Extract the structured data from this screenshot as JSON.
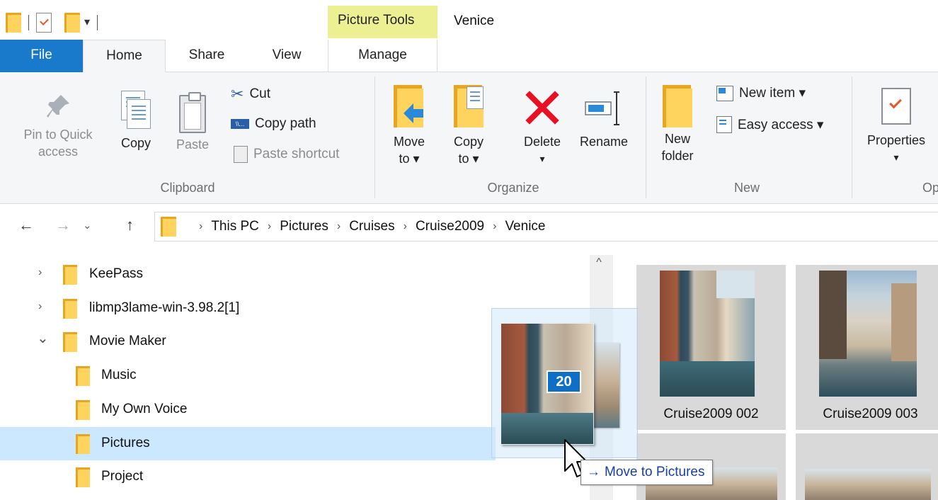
{
  "title_bar": {
    "contextual_tab_group": "Picture Tools",
    "window_title": "Venice"
  },
  "tabs": {
    "file": "File",
    "home": "Home",
    "share": "Share",
    "view": "View",
    "manage": "Manage"
  },
  "ribbon": {
    "clipboard": {
      "group_label": "Clipboard",
      "pin_line1": "Pin to Quick",
      "pin_line2": "access",
      "copy": "Copy",
      "paste": "Paste",
      "cut": "Cut",
      "copy_path": "Copy path",
      "paste_shortcut": "Paste shortcut"
    },
    "organize": {
      "group_label": "Organize",
      "move_line1": "Move",
      "move_line2": "to ▾",
      "copy_line1": "Copy",
      "copy_line2": "to ▾",
      "delete": "Delete",
      "delete_arrow": "▾",
      "rename": "Rename"
    },
    "new": {
      "group_label": "New",
      "new_folder_line1": "New",
      "new_folder_line2": "folder",
      "new_item": "New item ▾",
      "easy_access": "Easy access ▾"
    },
    "open": {
      "group_label_partial": "Op",
      "properties": "Properties",
      "properties_arrow": "▾"
    }
  },
  "address_bar": {
    "breadcrumb": [
      "This PC",
      "Pictures",
      "Cruises",
      "Cruise2009",
      "Venice"
    ]
  },
  "nav_tree": {
    "items": [
      {
        "label": "KeePass",
        "chevron": "›",
        "indent": 0,
        "selected": false
      },
      {
        "label": "libmp3lame-win-3.98.2[1]",
        "chevron": "›",
        "indent": 0,
        "selected": false
      },
      {
        "label": "Movie Maker",
        "chevron": "⌄",
        "indent": 0,
        "selected": false
      },
      {
        "label": "Music",
        "chevron": "",
        "indent": 1,
        "selected": false
      },
      {
        "label": "My Own Voice",
        "chevron": "",
        "indent": 1,
        "selected": false
      },
      {
        "label": "Pictures",
        "chevron": "",
        "indent": 1,
        "selected": true
      },
      {
        "label": "Project",
        "chevron": "",
        "indent": 1,
        "selected": false
      }
    ]
  },
  "files": [
    {
      "name": "Cruise2009 002"
    },
    {
      "name": "Cruise2009 003"
    }
  ],
  "drag": {
    "count": "20",
    "tooltip_action": "Move to Pictures"
  },
  "colors": {
    "file_tab": "#1979ca",
    "contextual_tab": "#ecf093",
    "selection": "#cce8ff",
    "folder": "#ffd45e",
    "delete_red": "#e81123"
  }
}
